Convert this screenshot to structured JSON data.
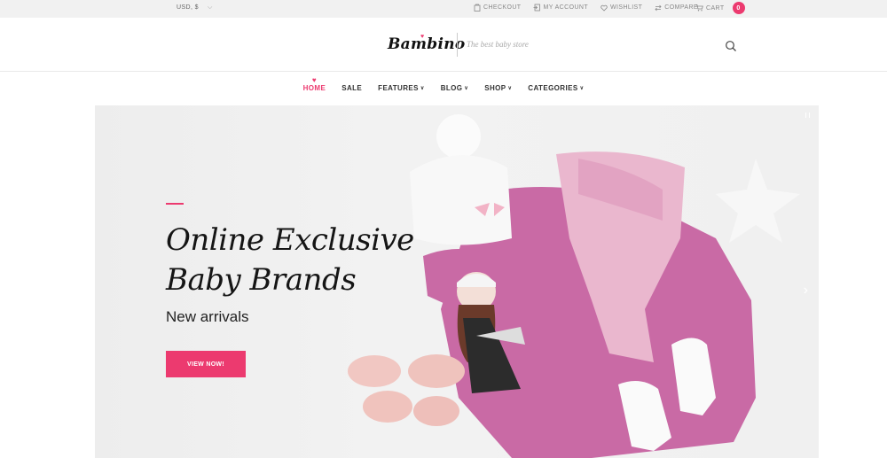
{
  "topbar": {
    "currency": "USD, $",
    "links": [
      {
        "label": "CHECKOUT",
        "icon": "checkout-icon"
      },
      {
        "label": "MY ACCOUNT",
        "icon": "account-icon"
      },
      {
        "label": "WISHLIST",
        "icon": "heart-icon"
      },
      {
        "label": "COMPARE",
        "icon": "compare-icon"
      }
    ],
    "cart_label": "CART",
    "cart_count": "0"
  },
  "header": {
    "logo": "Bambino",
    "tagline": "The best baby store"
  },
  "nav": {
    "items": [
      {
        "label": "HOME",
        "active": true
      },
      {
        "label": "SALE"
      },
      {
        "label": "FEATURES",
        "dropdown": true
      },
      {
        "label": "BLOG",
        "dropdown": true
      },
      {
        "label": "SHOP",
        "dropdown": true
      },
      {
        "label": "CATEGORIES",
        "dropdown": true
      }
    ]
  },
  "hero": {
    "title_line1": "Online Exclusive",
    "title_line2": "Baby Brands",
    "subtitle": "New arrivals",
    "cta": "VIEW NOW!"
  },
  "colors": {
    "accent": "#ec3a6f"
  }
}
